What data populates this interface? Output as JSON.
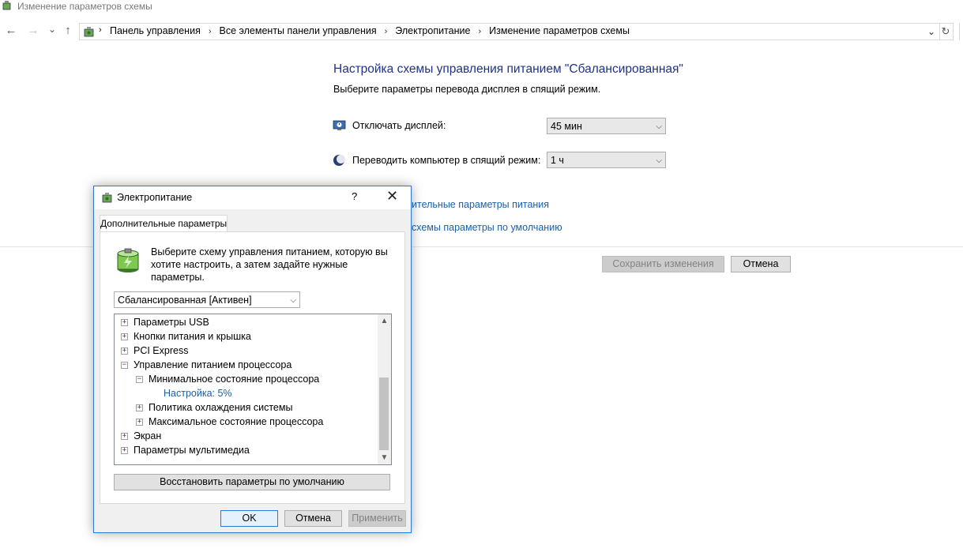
{
  "window": {
    "title": "Изменение параметров схемы"
  },
  "nav": {
    "back_icon": "←",
    "forward_icon": "→",
    "recent_icon": "⌄",
    "up_icon": "↑",
    "breadcrumbs": [
      "Панель управления",
      "Все элементы панели управления",
      "Электропитание",
      "Изменение параметров схемы"
    ],
    "separator": "›",
    "dropdown_icon": "⌄",
    "refresh_icon": "↻"
  },
  "main": {
    "heading": "Настройка схемы управления питанием \"Сбалансированная\"",
    "subheading": "Выберите параметры перевода дисплея в спящий режим.",
    "display_off": {
      "label": "Отключать дисплей:",
      "value": "45 мин"
    },
    "sleep": {
      "label": "Переводить компьютер в спящий режим:",
      "value": "1 ч"
    },
    "link_advanced": "ительные параметры питания",
    "link_restore": "схемы параметры по умолчанию",
    "save_button": "Сохранить изменения",
    "cancel_button": "Отмена"
  },
  "dialog": {
    "title": "Электропитание",
    "help": "?",
    "close": "✕",
    "tab": "Дополнительные параметры",
    "description": "Выберите схему управления питанием, которую вы хотите настроить, а затем задайте нужные параметры.",
    "scheme": "Сбалансированная [Активен]",
    "tree": [
      {
        "label": "Параметры USB",
        "sign": "+"
      },
      {
        "label": "Кнопки питания и крышка",
        "sign": "+"
      },
      {
        "label": "PCI Express",
        "sign": "+"
      },
      {
        "label": "Управление питанием процессора",
        "sign": "−"
      },
      {
        "label": "Минимальное состояние процессора",
        "sign": "−"
      },
      {
        "label": "Настройка: 5%",
        "sign": ""
      },
      {
        "label": "Политика охлаждения системы",
        "sign": "+"
      },
      {
        "label": "Максимальное состояние процессора",
        "sign": "+"
      },
      {
        "label": "Экран",
        "sign": "+"
      },
      {
        "label": "Параметры мультимедиа",
        "sign": "+"
      }
    ],
    "restore_button": "Восстановить параметры по умолчанию",
    "ok_button": "OK",
    "cancel_button": "Отмена",
    "apply_button": "Применить"
  },
  "colors": {
    "heading": "#1e3287",
    "link": "#1a5fa8",
    "setting_value": "#1a5fa8",
    "dialog_border": "#2b79d0"
  }
}
